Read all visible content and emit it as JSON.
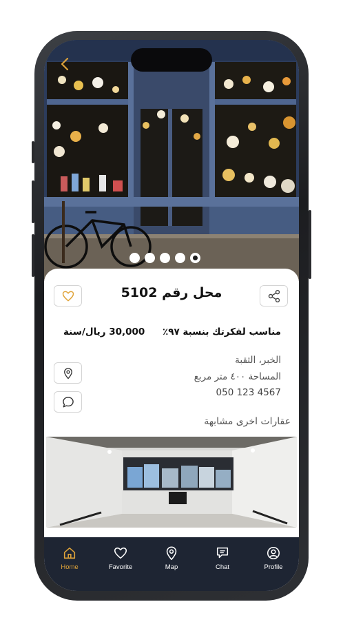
{
  "property": {
    "title": "محل رقم 5102",
    "match_text": "مناسب لفكرتك بنسبة ٩٧٪",
    "price": "30,000 ريال/سنة",
    "location": "الخبر، الثقبة",
    "area": "المساحة ٤٠٠ متر مربع",
    "phone": "050 123 4567",
    "similar_title": "عقارات اخرى مشابهة"
  },
  "carousel": {
    "count": 5,
    "active_index": 4
  },
  "nav": {
    "items": [
      {
        "label": "Home",
        "icon": "home-icon",
        "active": true
      },
      {
        "label": "Favorite",
        "icon": "heart-icon",
        "active": false
      },
      {
        "label": "Map",
        "icon": "map-pin-icon",
        "active": false
      },
      {
        "label": "Chat",
        "icon": "chat-icon",
        "active": false
      },
      {
        "label": "Profile",
        "icon": "profile-icon",
        "active": false
      }
    ]
  },
  "colors": {
    "accent": "#e0a43a",
    "nav_bg": "#1e2533",
    "text": "#111111"
  }
}
